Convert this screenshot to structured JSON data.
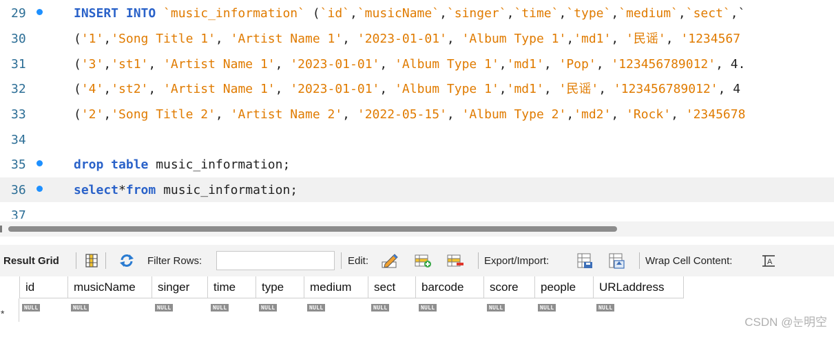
{
  "editor": {
    "lines": [
      {
        "num": "29",
        "dot": true,
        "tokens": [
          {
            "t": "INSERT INTO ",
            "c": "kw"
          },
          {
            "t": "`music_information`",
            "c": "bt"
          },
          {
            "t": " (",
            "c": "plain"
          },
          {
            "t": "`id`",
            "c": "bt"
          },
          {
            "t": ",",
            "c": "plain"
          },
          {
            "t": "`musicName`",
            "c": "bt"
          },
          {
            "t": ",",
            "c": "plain"
          },
          {
            "t": "`singer`",
            "c": "bt"
          },
          {
            "t": ",",
            "c": "plain"
          },
          {
            "t": "`time`",
            "c": "bt"
          },
          {
            "t": ",",
            "c": "plain"
          },
          {
            "t": "`type`",
            "c": "bt"
          },
          {
            "t": ",",
            "c": "plain"
          },
          {
            "t": "`medium`",
            "c": "bt"
          },
          {
            "t": ",",
            "c": "plain"
          },
          {
            "t": "`sect`",
            "c": "bt"
          },
          {
            "t": ",`",
            "c": "plain"
          }
        ]
      },
      {
        "num": "30",
        "dot": false,
        "tokens": [
          {
            "t": "(",
            "c": "plain"
          },
          {
            "t": "'1'",
            "c": "str"
          },
          {
            "t": ",",
            "c": "plain"
          },
          {
            "t": "'Song Title 1'",
            "c": "str"
          },
          {
            "t": ", ",
            "c": "plain"
          },
          {
            "t": "'Artist Name 1'",
            "c": "str"
          },
          {
            "t": ", ",
            "c": "plain"
          },
          {
            "t": "'2023-01-01'",
            "c": "str"
          },
          {
            "t": ", ",
            "c": "plain"
          },
          {
            "t": "'Album Type 1'",
            "c": "str"
          },
          {
            "t": ",",
            "c": "plain"
          },
          {
            "t": "'md1'",
            "c": "str"
          },
          {
            "t": ", ",
            "c": "plain"
          },
          {
            "t": "'民谣'",
            "c": "str"
          },
          {
            "t": ", ",
            "c": "plain"
          },
          {
            "t": "'1234567",
            "c": "str"
          }
        ]
      },
      {
        "num": "31",
        "dot": false,
        "tokens": [
          {
            "t": "(",
            "c": "plain"
          },
          {
            "t": "'3'",
            "c": "str"
          },
          {
            "t": ",",
            "c": "plain"
          },
          {
            "t": "'st1'",
            "c": "str"
          },
          {
            "t": ", ",
            "c": "plain"
          },
          {
            "t": "'Artist Name 1'",
            "c": "str"
          },
          {
            "t": ", ",
            "c": "plain"
          },
          {
            "t": "'2023-01-01'",
            "c": "str"
          },
          {
            "t": ", ",
            "c": "plain"
          },
          {
            "t": "'Album Type 1'",
            "c": "str"
          },
          {
            "t": ",",
            "c": "plain"
          },
          {
            "t": "'md1'",
            "c": "str"
          },
          {
            "t": ", ",
            "c": "plain"
          },
          {
            "t": "'Pop'",
            "c": "str"
          },
          {
            "t": ", ",
            "c": "plain"
          },
          {
            "t": "'123456789012'",
            "c": "str"
          },
          {
            "t": ", 4.",
            "c": "plain"
          }
        ]
      },
      {
        "num": "32",
        "dot": false,
        "tokens": [
          {
            "t": "(",
            "c": "plain"
          },
          {
            "t": "'4'",
            "c": "str"
          },
          {
            "t": ",",
            "c": "plain"
          },
          {
            "t": "'st2'",
            "c": "str"
          },
          {
            "t": ", ",
            "c": "plain"
          },
          {
            "t": "'Artist Name 1'",
            "c": "str"
          },
          {
            "t": ", ",
            "c": "plain"
          },
          {
            "t": "'2023-01-01'",
            "c": "str"
          },
          {
            "t": ", ",
            "c": "plain"
          },
          {
            "t": "'Album Type 1'",
            "c": "str"
          },
          {
            "t": ",",
            "c": "plain"
          },
          {
            "t": "'md1'",
            "c": "str"
          },
          {
            "t": ", ",
            "c": "plain"
          },
          {
            "t": "'民谣'",
            "c": "str"
          },
          {
            "t": ", ",
            "c": "plain"
          },
          {
            "t": "'123456789012'",
            "c": "str"
          },
          {
            "t": ", 4",
            "c": "plain"
          }
        ]
      },
      {
        "num": "33",
        "dot": false,
        "tokens": [
          {
            "t": "(",
            "c": "plain"
          },
          {
            "t": "'2'",
            "c": "str"
          },
          {
            "t": ",",
            "c": "plain"
          },
          {
            "t": "'Song Title 2'",
            "c": "str"
          },
          {
            "t": ", ",
            "c": "plain"
          },
          {
            "t": "'Artist Name 2'",
            "c": "str"
          },
          {
            "t": ", ",
            "c": "plain"
          },
          {
            "t": "'2022-05-15'",
            "c": "str"
          },
          {
            "t": ", ",
            "c": "plain"
          },
          {
            "t": "'Album Type 2'",
            "c": "str"
          },
          {
            "t": ",",
            "c": "plain"
          },
          {
            "t": "'md2'",
            "c": "str"
          },
          {
            "t": ", ",
            "c": "plain"
          },
          {
            "t": "'Rock'",
            "c": "str"
          },
          {
            "t": ", ",
            "c": "plain"
          },
          {
            "t": "'2345678",
            "c": "str"
          }
        ]
      },
      {
        "num": "34",
        "dot": false,
        "tokens": []
      },
      {
        "num": "35",
        "dot": true,
        "tokens": [
          {
            "t": "drop table ",
            "c": "kw"
          },
          {
            "t": "music_information;",
            "c": "plain"
          }
        ]
      },
      {
        "num": "36",
        "dot": true,
        "current": true,
        "tokens": [
          {
            "t": "select",
            "c": "kw"
          },
          {
            "t": "*",
            "c": "plain"
          },
          {
            "t": "from ",
            "c": "kw"
          },
          {
            "t": "music_information;",
            "c": "plain"
          }
        ]
      },
      {
        "num": "37",
        "dot": false,
        "tokens": []
      }
    ]
  },
  "toolbar": {
    "result_grid_label": "Result Grid",
    "filter_rows_label": "Filter Rows:",
    "filter_value": "",
    "edit_label": "Edit:",
    "export_import_label": "Export/Import:",
    "wrap_label": "Wrap Cell Content:"
  },
  "grid": {
    "columns": [
      "id",
      "musicName",
      "singer",
      "time",
      "type",
      "medium",
      "sect",
      "barcode",
      "score",
      "people",
      "URLaddress"
    ],
    "row": [
      "NULL",
      "NULL",
      "NULL",
      "NULL",
      "NULL",
      "NULL",
      "NULL",
      "NULL",
      "NULL",
      "NULL",
      "NULL"
    ],
    "row_marker": "*"
  },
  "watermark": "CSDN @눈明空",
  "colors": {
    "keyword": "#2a62c9",
    "string": "#e07b00",
    "line_number": "#2c6e96",
    "breakpoint_dot": "#1e90ff",
    "null_badge": "#8e8e8e"
  },
  "icons": [
    "grid-layout-icon",
    "refresh-icon",
    "edit-pencil-icon",
    "add-row-icon",
    "delete-row-icon",
    "export-icon",
    "import-icon",
    "wrap-text-icon"
  ]
}
